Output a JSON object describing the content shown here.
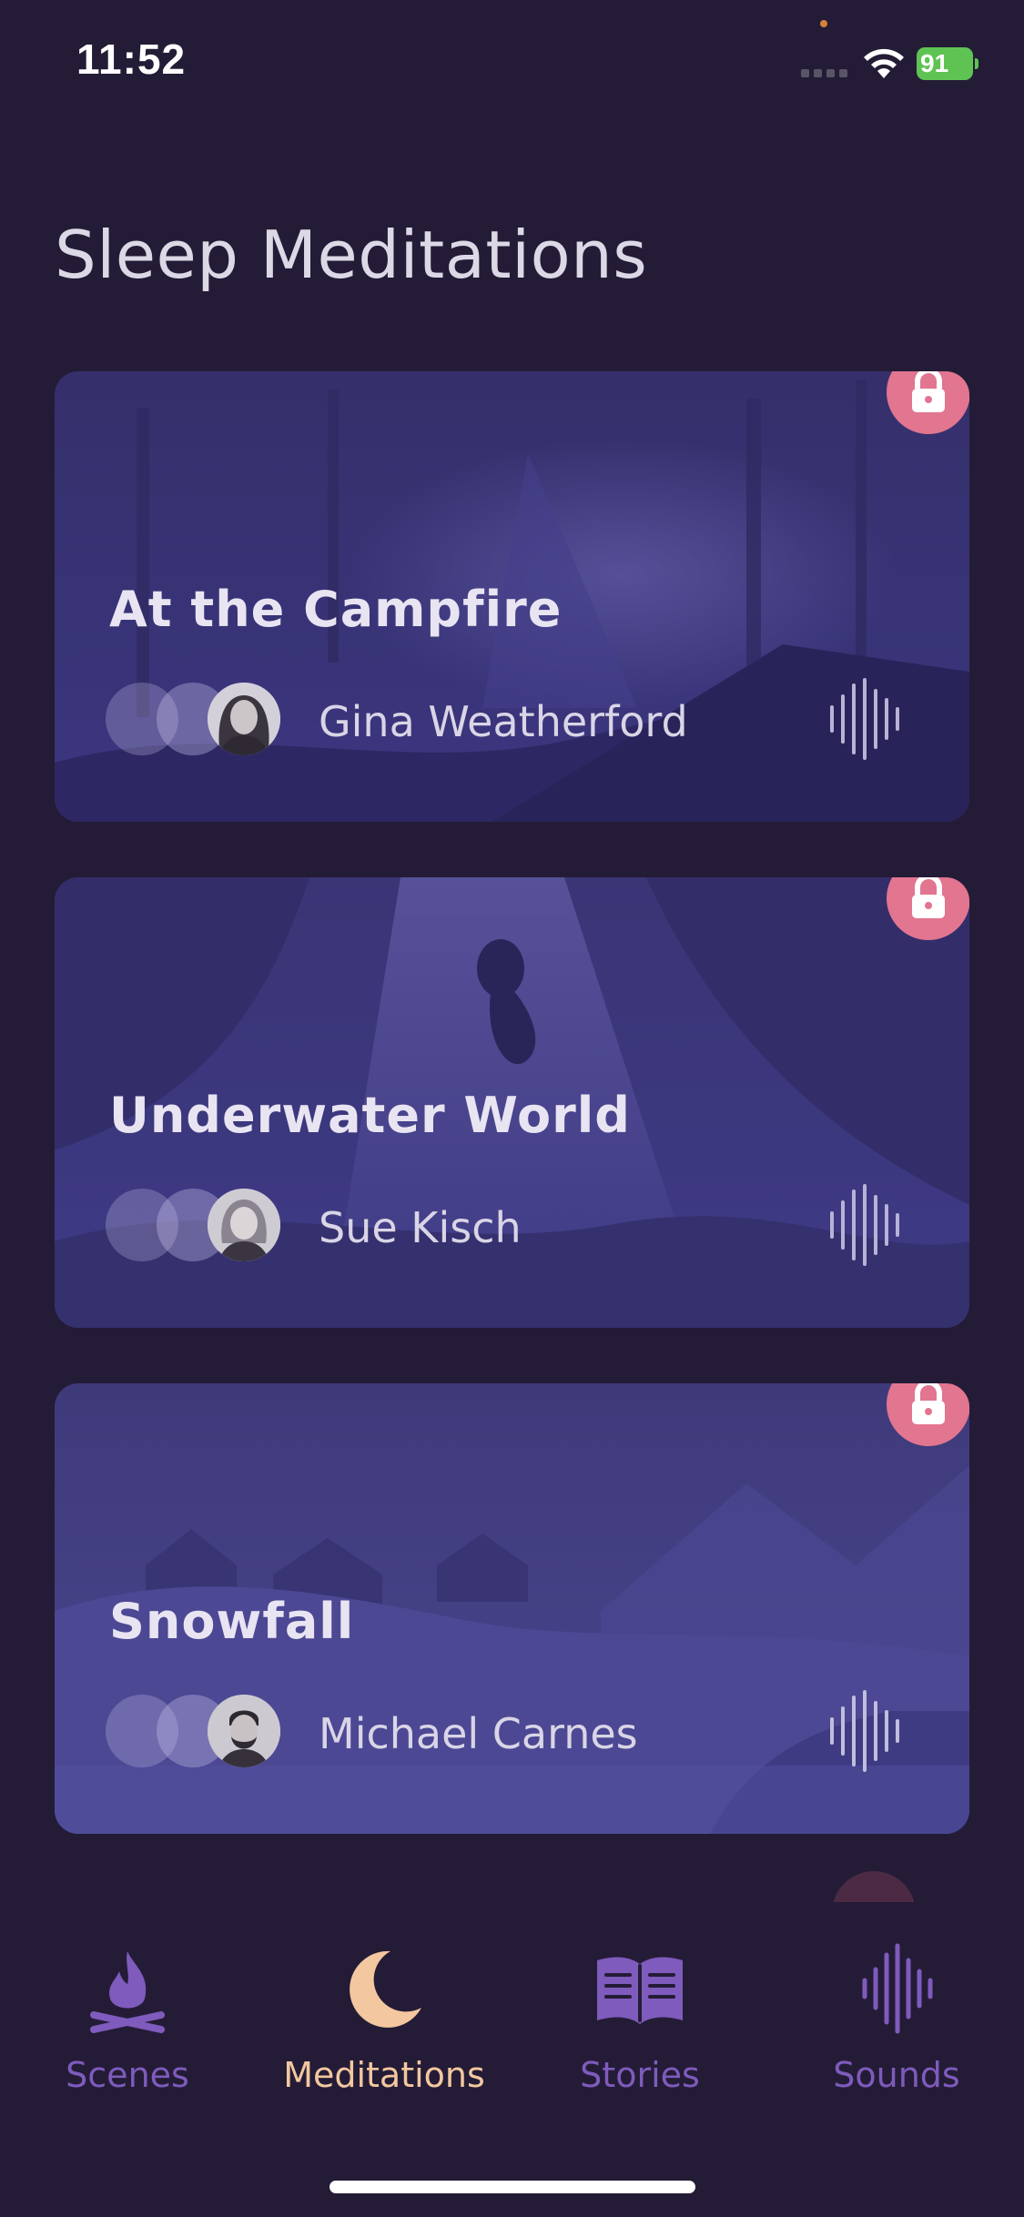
{
  "status": {
    "time": "11:52",
    "battery": "91"
  },
  "page": {
    "title": "Sleep Meditations"
  },
  "cards": [
    {
      "title": "At the Campfire",
      "author": "Gina Weatherford",
      "locked": true
    },
    {
      "title": "Underwater World",
      "author": "Sue Kisch",
      "locked": true
    },
    {
      "title": "Snowfall",
      "author": "Michael Carnes",
      "locked": true
    }
  ],
  "tabs": [
    {
      "label": "Scenes",
      "icon": "campfire-icon",
      "active": false
    },
    {
      "label": "Meditations",
      "icon": "crescent-moon-icon",
      "active": true
    },
    {
      "label": "Stories",
      "icon": "open-book-icon",
      "active": false
    },
    {
      "label": "Sounds",
      "icon": "sound-wave-icon",
      "active": false
    }
  ],
  "colors": {
    "background": "#241c36",
    "lock_badge": "#e2758f",
    "active_tab": "#f3c7a0",
    "inactive_tab": "#7e5bbd"
  }
}
